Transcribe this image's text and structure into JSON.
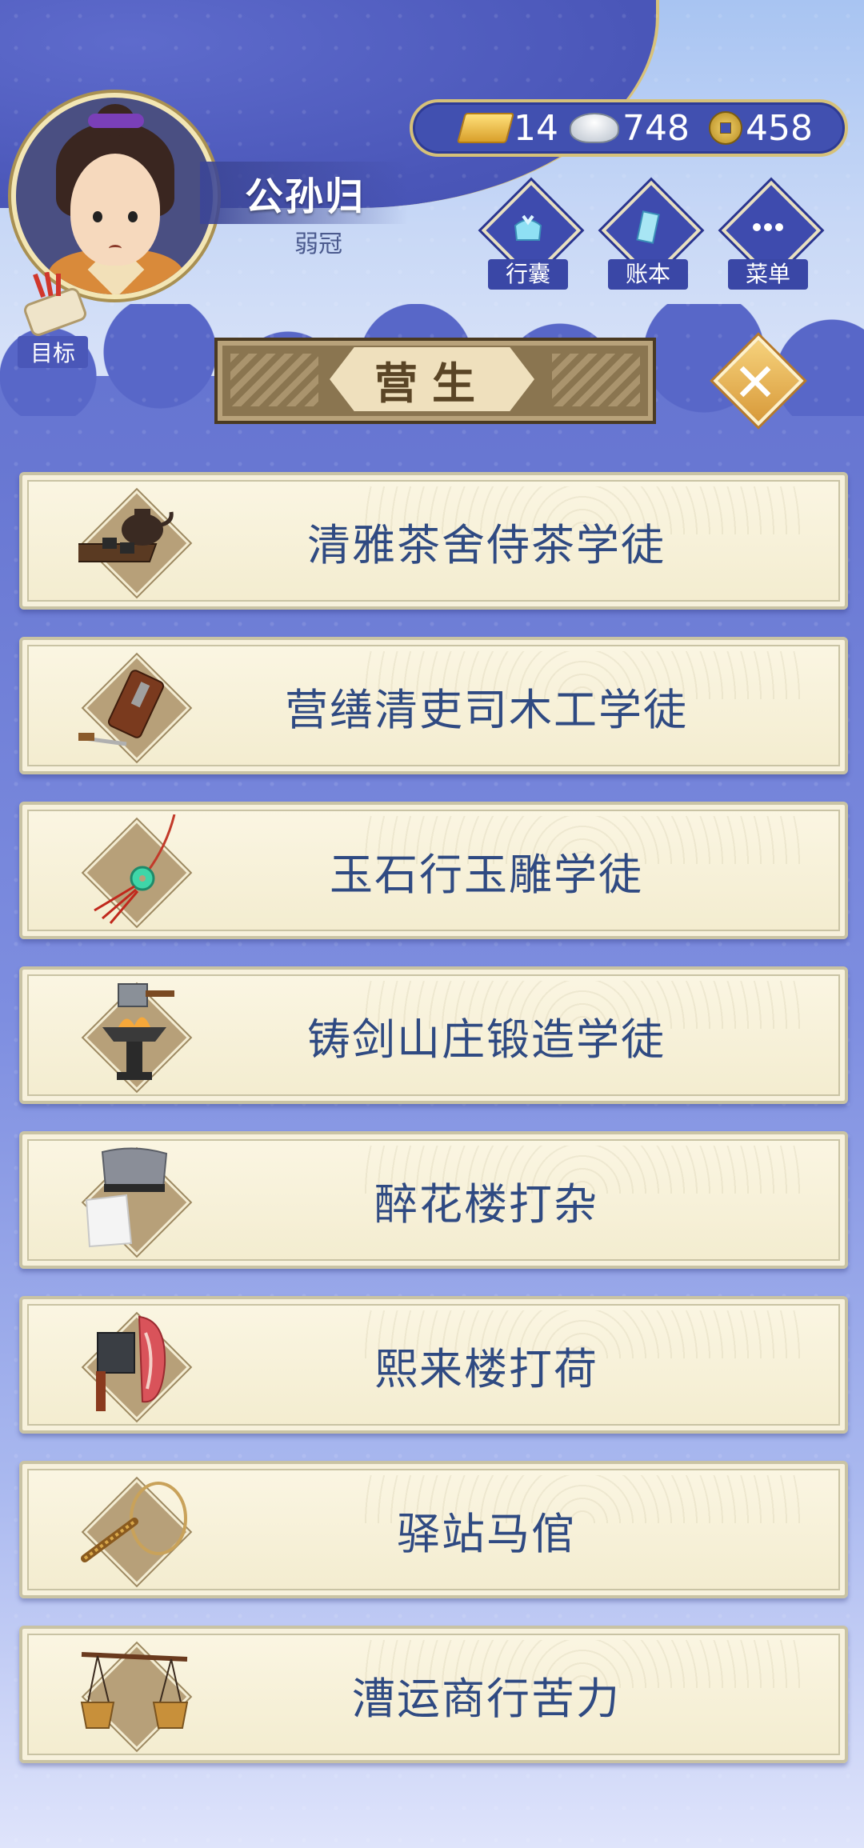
{
  "player": {
    "name": "公孙归",
    "title": "弱冠"
  },
  "target": {
    "label": "目标"
  },
  "currency": {
    "gold": "14",
    "silver": "748",
    "coins": "458"
  },
  "top_buttons": [
    {
      "label": "行囊",
      "icon": "bundle-icon"
    },
    {
      "label": "账本",
      "icon": "ledger-icon"
    },
    {
      "label": "菜单",
      "icon": "more-icon"
    }
  ],
  "header": {
    "title": "营生"
  },
  "jobs": [
    {
      "label": "清雅茶舍侍茶学徒",
      "icon": "tea-set-icon"
    },
    {
      "label": "营缮清吏司木工学徒",
      "icon": "wood-plane-icon"
    },
    {
      "label": "玉石行玉雕学徒",
      "icon": "jade-pendant-icon"
    },
    {
      "label": "铸剑山庄锻造学徒",
      "icon": "forge-hammer-icon"
    },
    {
      "label": "醉花楼打杂",
      "icon": "cloth-hat-icon"
    },
    {
      "label": "熙来楼打荷",
      "icon": "cleaver-meat-icon"
    },
    {
      "label": "驿站马倌",
      "icon": "horse-whip-icon"
    },
    {
      "label": "漕运商行苦力",
      "icon": "carrying-pole-icon"
    }
  ],
  "colors": {
    "accent_gold": "#d6c179",
    "panel_blue": "#4150b0",
    "card_text": "#2f4a82"
  }
}
